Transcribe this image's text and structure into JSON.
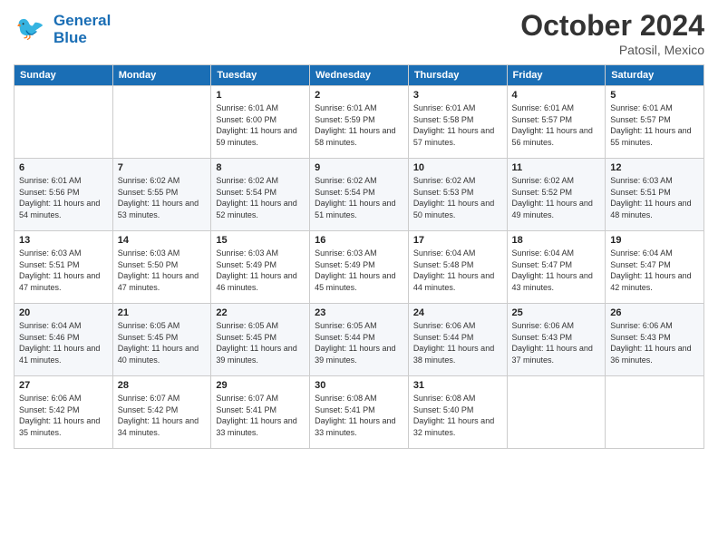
{
  "header": {
    "logo_line1": "General",
    "logo_line2": "Blue",
    "month": "October 2024",
    "location": "Patosil, Mexico"
  },
  "weekdays": [
    "Sunday",
    "Monday",
    "Tuesday",
    "Wednesday",
    "Thursday",
    "Friday",
    "Saturday"
  ],
  "weeks": [
    [
      {
        "day": "",
        "sunrise": "",
        "sunset": "",
        "daylight": ""
      },
      {
        "day": "",
        "sunrise": "",
        "sunset": "",
        "daylight": ""
      },
      {
        "day": "1",
        "sunrise": "Sunrise: 6:01 AM",
        "sunset": "Sunset: 6:00 PM",
        "daylight": "Daylight: 11 hours and 59 minutes."
      },
      {
        "day": "2",
        "sunrise": "Sunrise: 6:01 AM",
        "sunset": "Sunset: 5:59 PM",
        "daylight": "Daylight: 11 hours and 58 minutes."
      },
      {
        "day": "3",
        "sunrise": "Sunrise: 6:01 AM",
        "sunset": "Sunset: 5:58 PM",
        "daylight": "Daylight: 11 hours and 57 minutes."
      },
      {
        "day": "4",
        "sunrise": "Sunrise: 6:01 AM",
        "sunset": "Sunset: 5:57 PM",
        "daylight": "Daylight: 11 hours and 56 minutes."
      },
      {
        "day": "5",
        "sunrise": "Sunrise: 6:01 AM",
        "sunset": "Sunset: 5:57 PM",
        "daylight": "Daylight: 11 hours and 55 minutes."
      }
    ],
    [
      {
        "day": "6",
        "sunrise": "Sunrise: 6:01 AM",
        "sunset": "Sunset: 5:56 PM",
        "daylight": "Daylight: 11 hours and 54 minutes."
      },
      {
        "day": "7",
        "sunrise": "Sunrise: 6:02 AM",
        "sunset": "Sunset: 5:55 PM",
        "daylight": "Daylight: 11 hours and 53 minutes."
      },
      {
        "day": "8",
        "sunrise": "Sunrise: 6:02 AM",
        "sunset": "Sunset: 5:54 PM",
        "daylight": "Daylight: 11 hours and 52 minutes."
      },
      {
        "day": "9",
        "sunrise": "Sunrise: 6:02 AM",
        "sunset": "Sunset: 5:54 PM",
        "daylight": "Daylight: 11 hours and 51 minutes."
      },
      {
        "day": "10",
        "sunrise": "Sunrise: 6:02 AM",
        "sunset": "Sunset: 5:53 PM",
        "daylight": "Daylight: 11 hours and 50 minutes."
      },
      {
        "day": "11",
        "sunrise": "Sunrise: 6:02 AM",
        "sunset": "Sunset: 5:52 PM",
        "daylight": "Daylight: 11 hours and 49 minutes."
      },
      {
        "day": "12",
        "sunrise": "Sunrise: 6:03 AM",
        "sunset": "Sunset: 5:51 PM",
        "daylight": "Daylight: 11 hours and 48 minutes."
      }
    ],
    [
      {
        "day": "13",
        "sunrise": "Sunrise: 6:03 AM",
        "sunset": "Sunset: 5:51 PM",
        "daylight": "Daylight: 11 hours and 47 minutes."
      },
      {
        "day": "14",
        "sunrise": "Sunrise: 6:03 AM",
        "sunset": "Sunset: 5:50 PM",
        "daylight": "Daylight: 11 hours and 47 minutes."
      },
      {
        "day": "15",
        "sunrise": "Sunrise: 6:03 AM",
        "sunset": "Sunset: 5:49 PM",
        "daylight": "Daylight: 11 hours and 46 minutes."
      },
      {
        "day": "16",
        "sunrise": "Sunrise: 6:03 AM",
        "sunset": "Sunset: 5:49 PM",
        "daylight": "Daylight: 11 hours and 45 minutes."
      },
      {
        "day": "17",
        "sunrise": "Sunrise: 6:04 AM",
        "sunset": "Sunset: 5:48 PM",
        "daylight": "Daylight: 11 hours and 44 minutes."
      },
      {
        "day": "18",
        "sunrise": "Sunrise: 6:04 AM",
        "sunset": "Sunset: 5:47 PM",
        "daylight": "Daylight: 11 hours and 43 minutes."
      },
      {
        "day": "19",
        "sunrise": "Sunrise: 6:04 AM",
        "sunset": "Sunset: 5:47 PM",
        "daylight": "Daylight: 11 hours and 42 minutes."
      }
    ],
    [
      {
        "day": "20",
        "sunrise": "Sunrise: 6:04 AM",
        "sunset": "Sunset: 5:46 PM",
        "daylight": "Daylight: 11 hours and 41 minutes."
      },
      {
        "day": "21",
        "sunrise": "Sunrise: 6:05 AM",
        "sunset": "Sunset: 5:45 PM",
        "daylight": "Daylight: 11 hours and 40 minutes."
      },
      {
        "day": "22",
        "sunrise": "Sunrise: 6:05 AM",
        "sunset": "Sunset: 5:45 PM",
        "daylight": "Daylight: 11 hours and 39 minutes."
      },
      {
        "day": "23",
        "sunrise": "Sunrise: 6:05 AM",
        "sunset": "Sunset: 5:44 PM",
        "daylight": "Daylight: 11 hours and 39 minutes."
      },
      {
        "day": "24",
        "sunrise": "Sunrise: 6:06 AM",
        "sunset": "Sunset: 5:44 PM",
        "daylight": "Daylight: 11 hours and 38 minutes."
      },
      {
        "day": "25",
        "sunrise": "Sunrise: 6:06 AM",
        "sunset": "Sunset: 5:43 PM",
        "daylight": "Daylight: 11 hours and 37 minutes."
      },
      {
        "day": "26",
        "sunrise": "Sunrise: 6:06 AM",
        "sunset": "Sunset: 5:43 PM",
        "daylight": "Daylight: 11 hours and 36 minutes."
      }
    ],
    [
      {
        "day": "27",
        "sunrise": "Sunrise: 6:06 AM",
        "sunset": "Sunset: 5:42 PM",
        "daylight": "Daylight: 11 hours and 35 minutes."
      },
      {
        "day": "28",
        "sunrise": "Sunrise: 6:07 AM",
        "sunset": "Sunset: 5:42 PM",
        "daylight": "Daylight: 11 hours and 34 minutes."
      },
      {
        "day": "29",
        "sunrise": "Sunrise: 6:07 AM",
        "sunset": "Sunset: 5:41 PM",
        "daylight": "Daylight: 11 hours and 33 minutes."
      },
      {
        "day": "30",
        "sunrise": "Sunrise: 6:08 AM",
        "sunset": "Sunset: 5:41 PM",
        "daylight": "Daylight: 11 hours and 33 minutes."
      },
      {
        "day": "31",
        "sunrise": "Sunrise: 6:08 AM",
        "sunset": "Sunset: 5:40 PM",
        "daylight": "Daylight: 11 hours and 32 minutes."
      },
      {
        "day": "",
        "sunrise": "",
        "sunset": "",
        "daylight": ""
      },
      {
        "day": "",
        "sunrise": "",
        "sunset": "",
        "daylight": ""
      }
    ]
  ]
}
